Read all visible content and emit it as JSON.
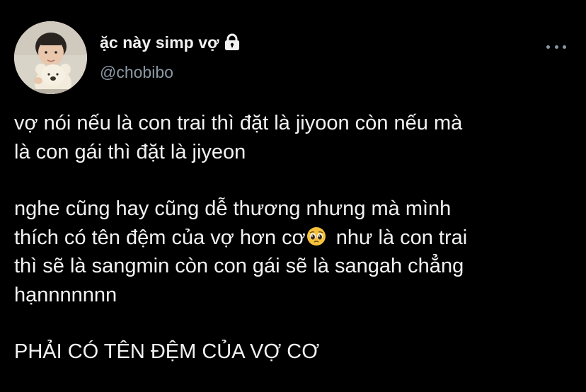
{
  "author": {
    "display_name": "ặc này simp vợ",
    "handle": "@chobibo",
    "avatar_icon": "profile-photo-child-with-teddy-bear",
    "protected_icon": "lock-icon"
  },
  "menu": {
    "more_icon": "more-horizontal-icon"
  },
  "tweet": {
    "paragraph1_line1": "vợ nói nếu là con trai thì đặt là jiyoon còn nếu mà",
    "paragraph1_line2": "là con gái thì đặt là jiyeon",
    "paragraph2_line1": "nghe cũng hay cũng dễ thương nhưng mà mình",
    "paragraph2_line2_before_emoji": "thích có tên đệm của vợ hơn cơ",
    "emoji_icon": "pleading-face-icon",
    "paragraph2_line2_after_emoji": " như là con trai",
    "paragraph2_line3": "thì sẽ là sangmin còn con gái sẽ là sangah chẳng",
    "paragraph2_line4": "hạnnnnnnn",
    "paragraph3": "PHẢI CÓ TÊN ĐỆM CỦA VỢ CƠ"
  },
  "colors": {
    "background": "#000000",
    "text": "#f2f2f2",
    "secondary": "#8b98a5"
  }
}
